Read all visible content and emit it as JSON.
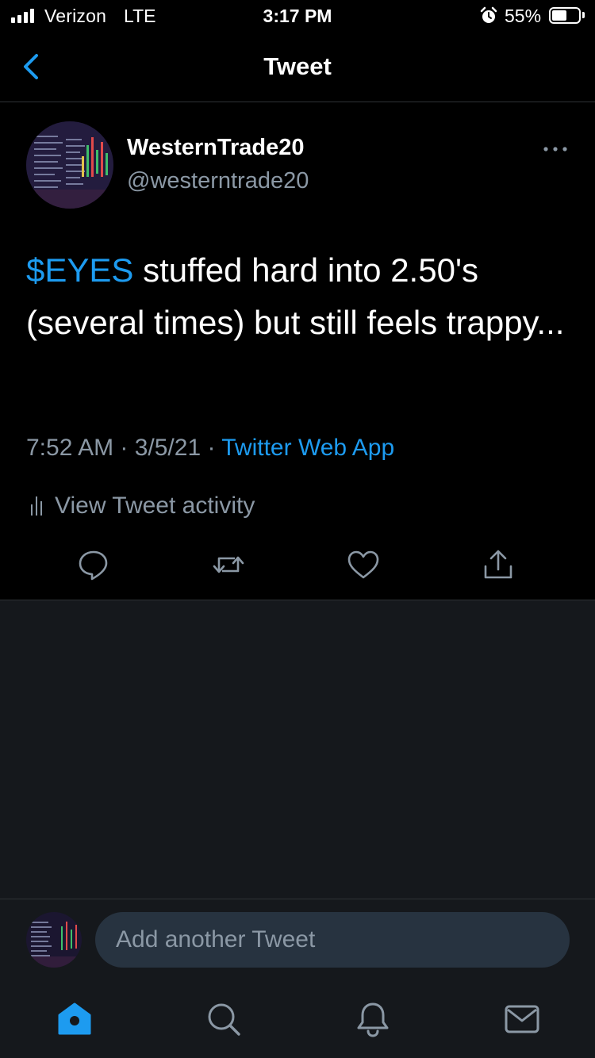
{
  "status_bar": {
    "carrier": "Verizon",
    "network": "LTE",
    "time": "3:17 PM",
    "battery": "55%",
    "battery_level": 0.55,
    "signal_bars": 4
  },
  "nav": {
    "title": "Tweet",
    "back_icon": "chevron-left-icon"
  },
  "tweet": {
    "display_name": "WesternTrade20",
    "handle": "@westerntrade20",
    "cashtag": "$EYES",
    "text": " stuffed hard into 2.50's (several times) but still feels trappy...",
    "timestamp": "7:52 AM · 3/5/21 · ",
    "source": "Twitter Web App",
    "activity_label": "View Tweet activity"
  },
  "actions": [
    "reply-icon",
    "retweet-icon",
    "like-icon",
    "share-icon"
  ],
  "reply_bar": {
    "placeholder": "Add another Tweet"
  },
  "tabs": [
    "home-icon",
    "search-icon",
    "notifications-icon",
    "messages-icon"
  ],
  "colors": {
    "accent": "#1d9bf0",
    "secondary_text": "#8b98a5",
    "background": "#000000",
    "panel": "#15181c"
  }
}
